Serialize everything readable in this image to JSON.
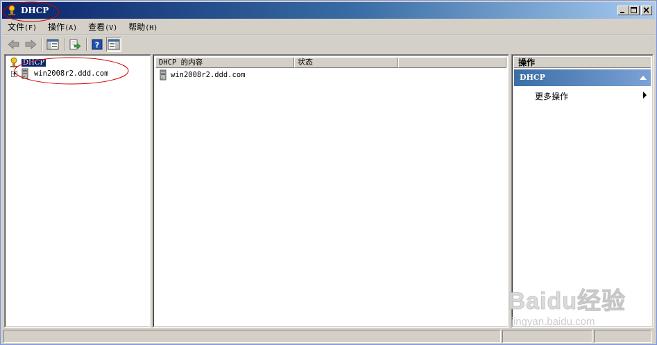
{
  "window": {
    "title": "DHCP"
  },
  "menu": [
    {
      "label": "文件",
      "accel": "(F)"
    },
    {
      "label": "操作",
      "accel": "(A)"
    },
    {
      "label": "查看",
      "accel": "(V)"
    },
    {
      "label": "帮助",
      "accel": "(H)"
    }
  ],
  "toolbar": {
    "icons": [
      "back-arrow-icon",
      "forward-arrow-icon",
      "show-hide-tree-icon",
      "export-list-icon",
      "help-icon",
      "show-hide-action-pane-icon"
    ]
  },
  "tree": {
    "root_label": "DHCP",
    "server_label": "win2008r2.ddd.com"
  },
  "list": {
    "columns": [
      "DHCP 的内容",
      "状态"
    ],
    "rows": [
      {
        "name": "win2008r2.ddd.com",
        "status": ""
      }
    ]
  },
  "actions": {
    "title": "操作",
    "section": "DHCP",
    "items": [
      "更多操作"
    ]
  },
  "watermark": {
    "main": "Baidu经验",
    "sub": "jingyan.baidu.com"
  },
  "colors": {
    "title_start": "#0a246a",
    "title_end": "#a6caf0",
    "selection": "#0a246a",
    "annotation": "#cc0000"
  }
}
